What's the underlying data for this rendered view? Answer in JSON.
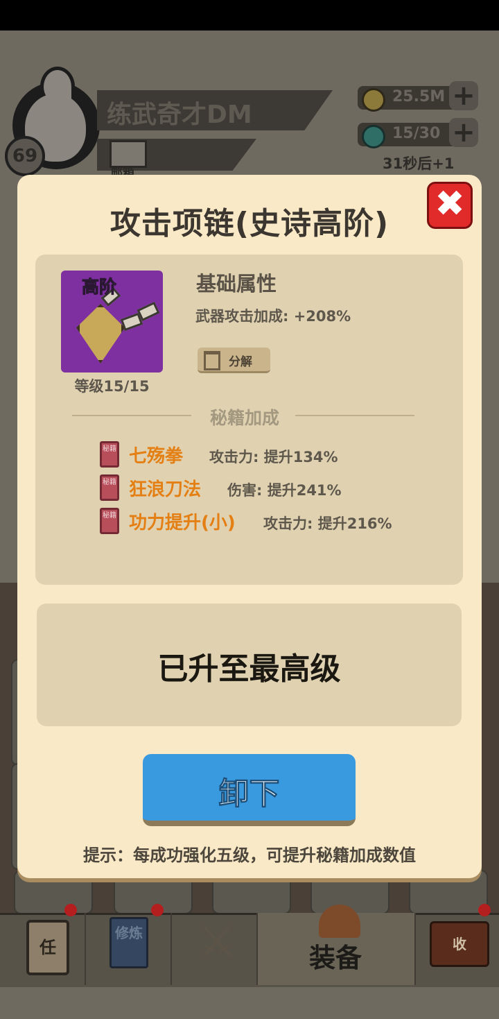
{
  "player": {
    "name": "练武奇才DM",
    "level": "69",
    "mail_label": "邮箱"
  },
  "resources": {
    "coins": "25.5M",
    "energy": "15/30",
    "energy_timer": "31秒后+1"
  },
  "dialog": {
    "title": "攻击项链(史诗高阶)",
    "item": {
      "tier_label": "高阶",
      "level_label": "等级15/15"
    },
    "base_section": {
      "heading": "基础属性",
      "stat": "武器攻击加成: +208%",
      "decompose_label": "分解"
    },
    "secret_section": {
      "heading": "秘籍加成",
      "book_glyph": "秘籍",
      "skills": [
        {
          "name": "七殇拳",
          "effect": "攻击力: 提升134%"
        },
        {
          "name": "狂浪刀法",
          "effect": "伤害: 提升241%"
        },
        {
          "name": "功力提升(小)",
          "effect": "攻击力: 提升216%"
        }
      ]
    },
    "max_level_text": "已升至最高级",
    "unequip_label": "卸下",
    "tip": "提示：每成功强化五级，可提升秘籍加成数值",
    "close_glyph": "✖"
  },
  "nav": {
    "task_glyph": "任",
    "cultivate_glyph": "修炼",
    "equip_label": "装备",
    "collect_glyph": "收"
  },
  "colors": {
    "modal_bg": "#f9e9c6",
    "panel_bg": "#e0d2b1",
    "skill_name": "#e47f14",
    "button_blue": "#3a9ae0",
    "close_red": "#e12a2a",
    "item_purple": "#7e2fa0"
  }
}
